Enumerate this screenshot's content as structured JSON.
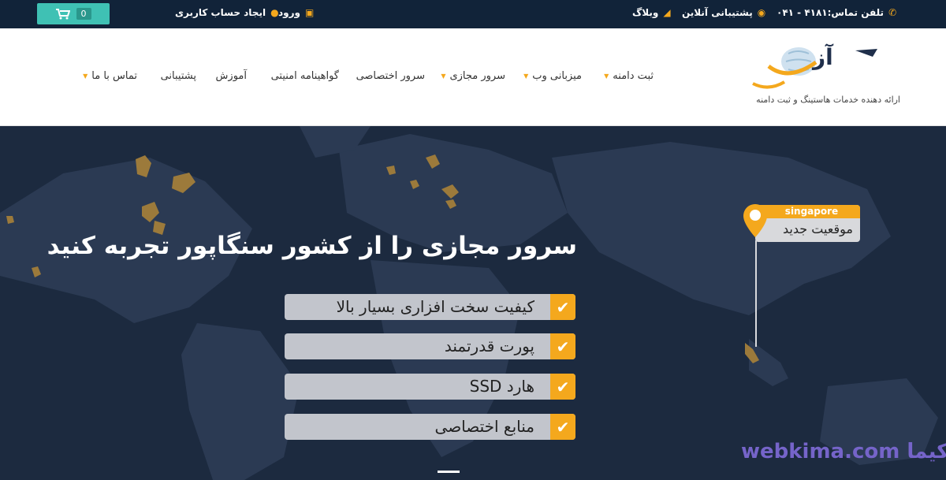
{
  "topbar": {
    "cart_count": "0",
    "signup_label": "ایجاد حساب کاربری",
    "login_label": "ورود",
    "blog_label": "وبلاگ",
    "support_label": "پشتیبانی آنلاین",
    "phone_label": "تلفن تماس:۴۱۸۱ - ۰۴۱"
  },
  "header": {
    "tagline": "ارائه دهنده خدمات هاستینگ و ثبت دامنه",
    "nav": [
      {
        "label": "ثبت دامنه",
        "has_dropdown": true
      },
      {
        "label": "میزبانی وب",
        "has_dropdown": true
      },
      {
        "label": "سرور مجازی",
        "has_dropdown": true
      },
      {
        "label": "سرور اختصاصی",
        "has_dropdown": false
      },
      {
        "label": "گواهینامه امنیتی",
        "has_dropdown": false
      },
      {
        "label": "آموزش",
        "has_dropdown": false
      },
      {
        "label": "پشتیبانی",
        "has_dropdown": false
      },
      {
        "label": "تماس با ما",
        "has_dropdown": true
      }
    ]
  },
  "hero": {
    "headline": "سرور مجازی را از کشور سنگاپور تجربه کنید",
    "features": [
      "کیفیت سخت افزاری بسیار بالا",
      "پورت قدرتمند",
      "هارد SSD",
      "منابع اختصاصی"
    ],
    "location_city": "singapore",
    "location_label": "موقعیت جدید"
  },
  "watermark": "webkima.com وب کیما",
  "colors": {
    "accent": "#f4a81d",
    "teal": "#3fc1b4",
    "dark": "#112339"
  }
}
